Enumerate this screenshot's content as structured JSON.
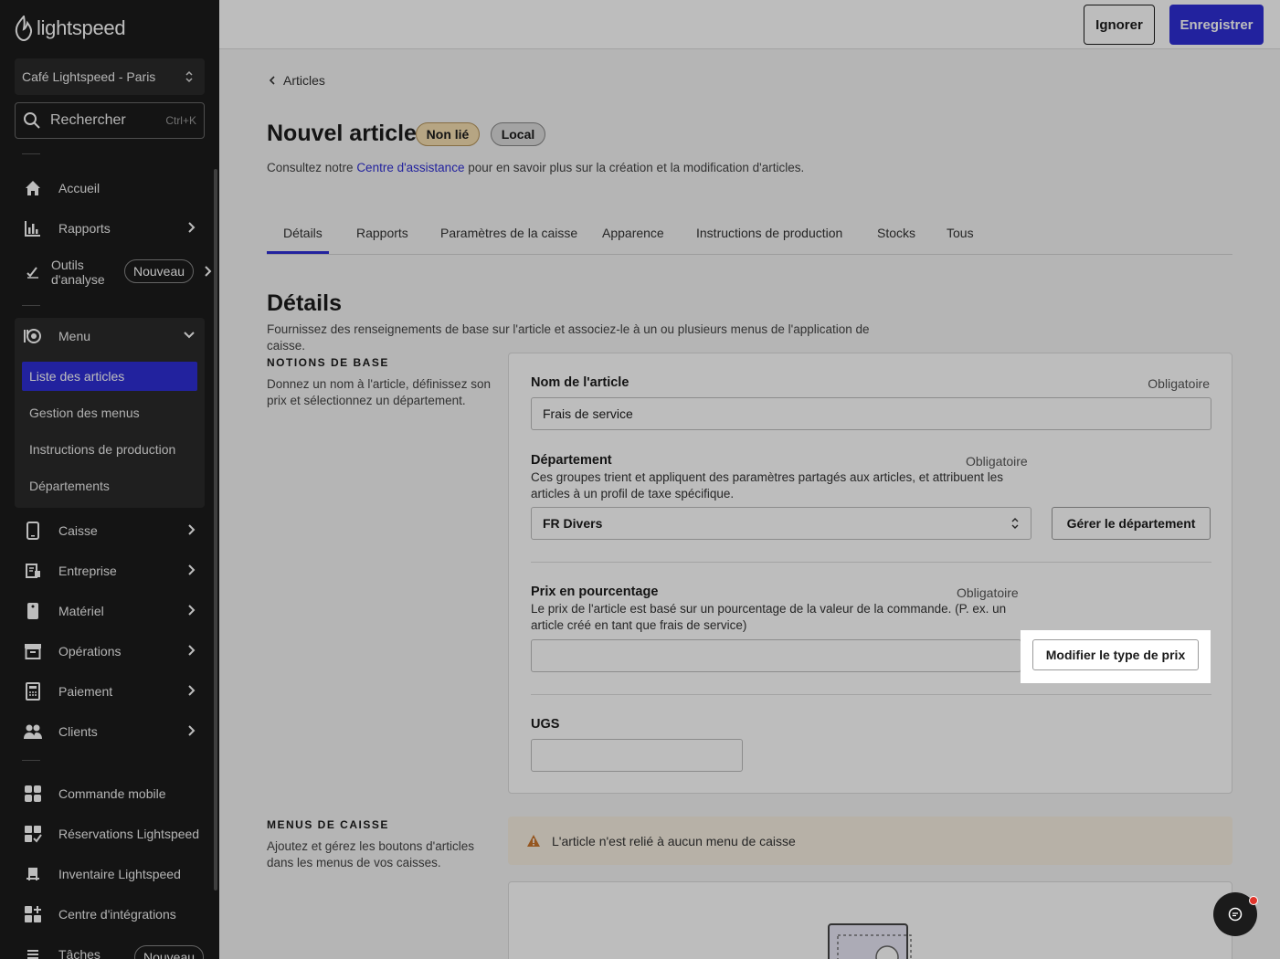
{
  "brand": {
    "name": "lightspeed"
  },
  "sidebar": {
    "store": "Café Lightspeed - Paris",
    "search": {
      "label": "Rechercher",
      "shortcut": "Ctrl+K"
    },
    "items": [
      {
        "label": "Accueil",
        "icon": "home-icon"
      },
      {
        "label": "Rapports",
        "icon": "bar-chart-icon"
      },
      {
        "label_line1": "Outils",
        "label_line2": "d'analyse",
        "badge": "Nouveau",
        "icon": "analytics-icon"
      },
      {
        "label": "Menu",
        "icon": "menu-icon"
      },
      {
        "label": "Caisse",
        "icon": "tablet-icon"
      },
      {
        "label": "Entreprise",
        "icon": "business-icon"
      },
      {
        "label": "Matériel",
        "icon": "device-icon"
      },
      {
        "label": "Opérations",
        "icon": "archive-icon"
      },
      {
        "label": "Paiement",
        "icon": "payment-icon"
      },
      {
        "label": "Clients",
        "icon": "clients-icon"
      },
      {
        "label": "Commande mobile",
        "icon": "grid-icon"
      },
      {
        "label": "Réservations Lightspeed",
        "icon": "grid-check-icon"
      },
      {
        "label": "Inventaire Lightspeed",
        "icon": "inventory-icon"
      },
      {
        "label": "Centre d'intégrations",
        "icon": "integrations-icon"
      },
      {
        "label": "Tâches",
        "badge": "Nouveau",
        "icon": "tasks-icon"
      }
    ],
    "menu_sub": [
      "Liste des articles",
      "Gestion des menus",
      "Instructions de production",
      "Départements"
    ]
  },
  "topbar": {
    "ignore": "Ignorer",
    "save": "Enregistrer"
  },
  "main": {
    "breadcrumb": "Articles",
    "title": "Nouvel article",
    "badges": [
      "Non lié",
      "Local"
    ],
    "help_prefix": "Consultez notre ",
    "help_link": "Centre d'assistance",
    "help_suffix": " pour en savoir plus sur la création et la modification d'articles.",
    "tabs": [
      "Détails",
      "Rapports",
      "Paramètres de la caisse",
      "Apparence",
      "Instructions de production",
      "Stocks",
      "Tous"
    ],
    "section_title": "Détails",
    "section_desc": "Fournissez des renseignements de base sur l'article et associez-le à un ou plusieurs menus de l'application de caisse.",
    "basics": {
      "label": "NOTIONS DE BASE",
      "desc": "Donnez un nom à l'article, définissez son prix et sélectionnez un département."
    },
    "form": {
      "name_label": "Nom de l'article",
      "name_req": "Obligatoire",
      "name_value": "Frais de service",
      "dept_label": "Département",
      "dept_req": "Obligatoire",
      "dept_hint": "Ces groupes trient et appliquent des paramètres partagés aux articles, et attribuent les articles à un profil de taxe spécifique.",
      "dept_value": "FR Divers",
      "dept_button": "Gérer le département",
      "price_label": "Prix en pourcentage",
      "price_req": "Obligatoire",
      "price_hint": "Le prix de l'article est basé sur un pourcentage de la valeur de la commande. (P. ex. un article créé en tant que frais de service)",
      "price_value": "",
      "price_button": "Modifier le type de prix",
      "sku_label": "UGS",
      "sku_value": ""
    },
    "pos_menus": {
      "label": "MENUS DE CAISSE",
      "desc": "Ajoutez et gérez les boutons d'articles dans les menus de vos caisses.",
      "warning": "L'article n'est relié à aucun menu de caisse"
    }
  },
  "colors": {
    "accent": "#2f2fd6",
    "sidebar_bg": "#1b1b1b",
    "warning_bg": "#f7efe2",
    "warning_icon": "#c9752b"
  }
}
